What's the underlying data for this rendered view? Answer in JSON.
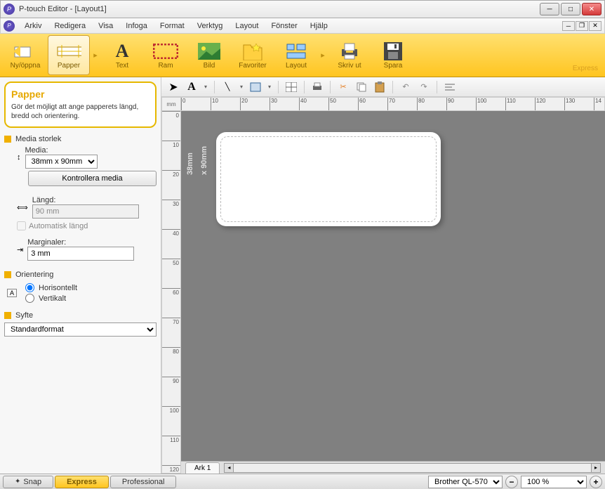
{
  "title": "P-touch Editor - [Layout1]",
  "menu": [
    "Arkiv",
    "Redigera",
    "Visa",
    "Infoga",
    "Format",
    "Verktyg",
    "Layout",
    "Fönster",
    "Hjälp"
  ],
  "ribbon": {
    "items": [
      {
        "label": "Ny/öppna"
      },
      {
        "label": "Papper"
      },
      {
        "label": "Text"
      },
      {
        "label": "Ram"
      },
      {
        "label": "Bild"
      },
      {
        "label": "Favoriter"
      },
      {
        "label": "Layout"
      },
      {
        "label": "Skriv ut"
      },
      {
        "label": "Spara"
      }
    ],
    "tag": "Express"
  },
  "sidebar": {
    "panel_title": "Papper",
    "panel_desc": "Gör det möjligt att ange papperets längd, bredd och orientering.",
    "media_storlek": "Media storlek",
    "media_label": "Media:",
    "media_value": "38mm x 90mm",
    "check_media": "Kontrollera media",
    "langd_label": "Längd:",
    "langd_value": "90 mm",
    "auto_langd": "Automatisk längd",
    "marg_label": "Marginaler:",
    "marg_value": "3 mm",
    "orientering": "Orientering",
    "horis": "Horisontellt",
    "vert": "Vertikalt",
    "syfte": "Syfte",
    "syfte_value": "Standardformat"
  },
  "ruler_unit": "mm",
  "ruler_ticks": [
    "0",
    "10",
    "20",
    "30",
    "40",
    "50",
    "60",
    "70",
    "80",
    "90",
    "100",
    "110",
    "120",
    "130",
    "14"
  ],
  "vruler_ticks": [
    "0",
    "10",
    "20",
    "30",
    "40",
    "50",
    "60",
    "70",
    "80",
    "90",
    "100",
    "110",
    "120"
  ],
  "dim1": "38mm",
  "dim2": "x 90mm",
  "sheet": "Ark 1",
  "modes": {
    "snap": "Snap",
    "express": "Express",
    "professional": "Professional"
  },
  "printer": "Brother QL-570",
  "zoom": "100 %"
}
